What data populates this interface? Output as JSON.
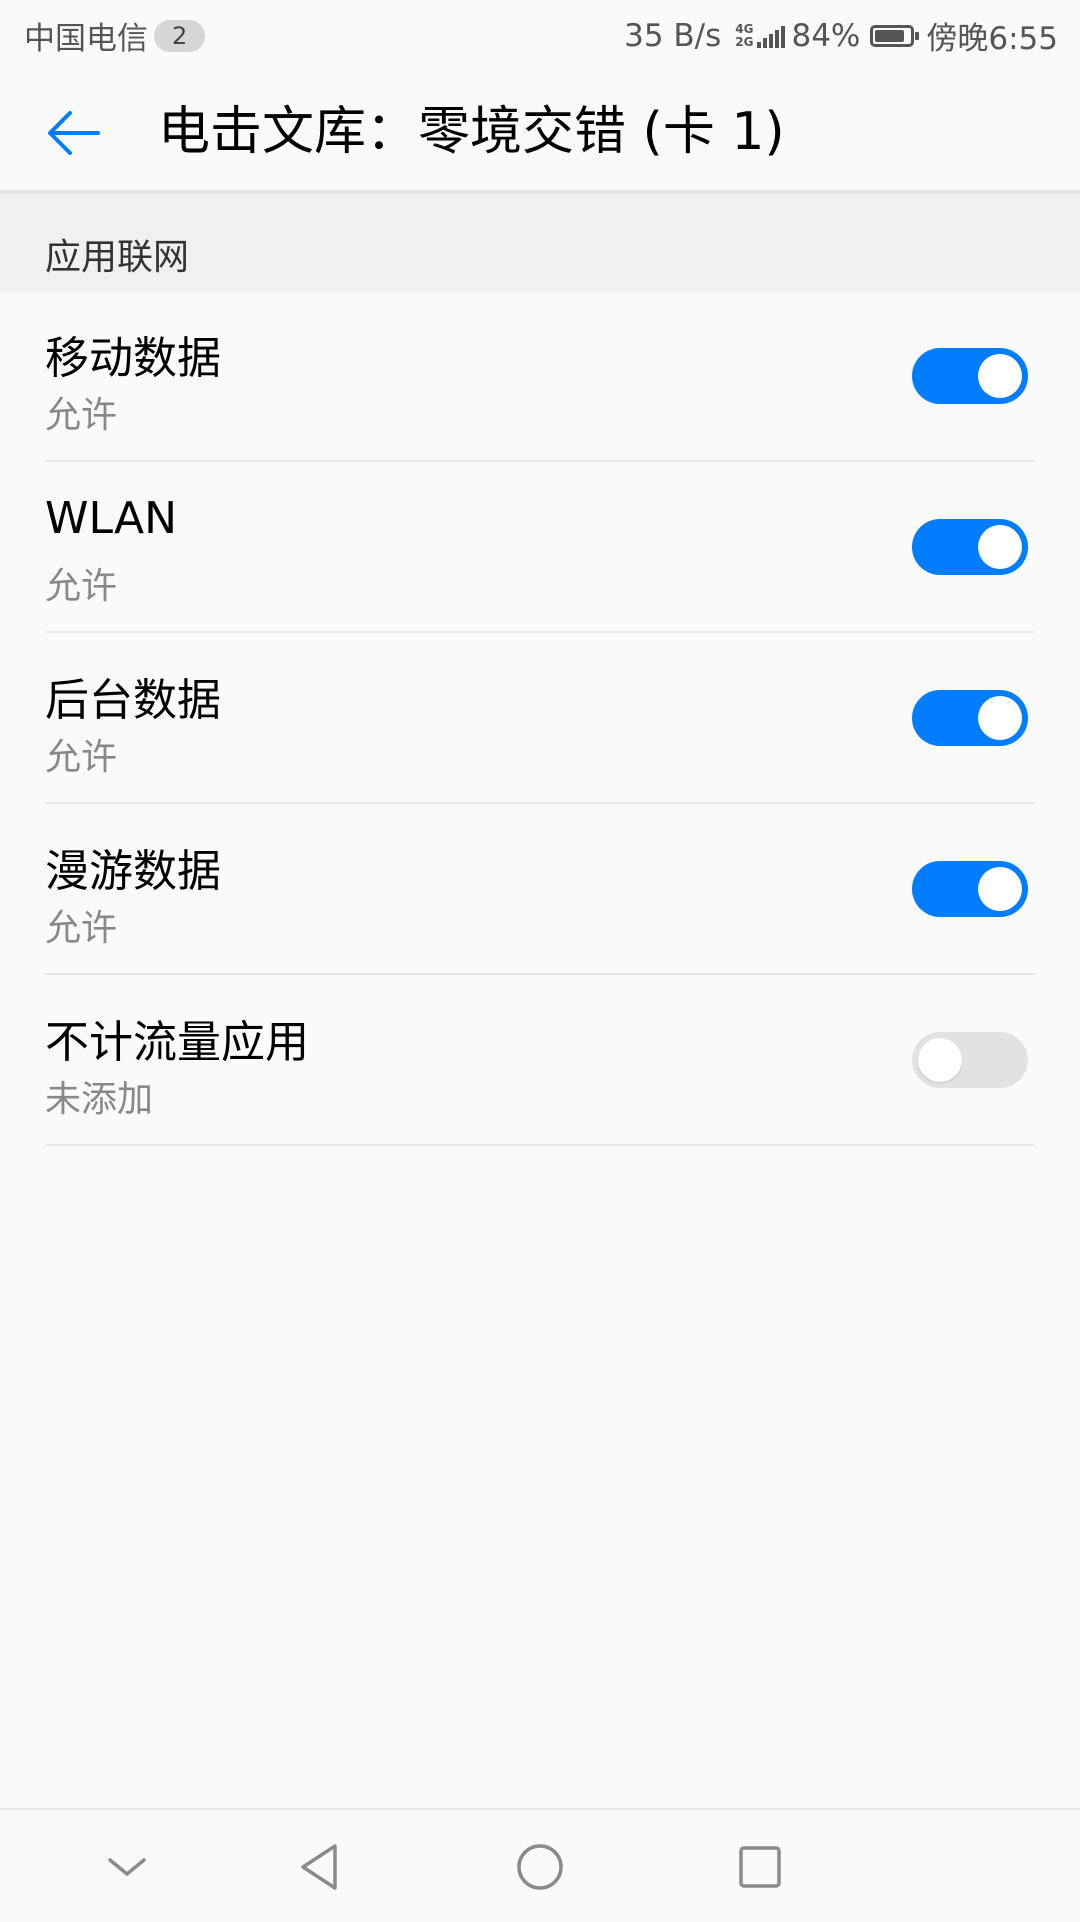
{
  "status_bar": {
    "carrier": "中国电信",
    "sim_badge": "2",
    "net_speed": "35 B/s",
    "network_top": "4G",
    "network_bottom": "2G",
    "battery_percent": "84%",
    "battery_level": 0.84,
    "time": "傍晚6:55"
  },
  "header": {
    "back_icon": "arrow-left-icon",
    "title": "电击文库：零境交错 (卡 1)",
    "accent_color": "#007dff"
  },
  "section": {
    "title": "应用联网"
  },
  "settings": [
    {
      "title": "移动数据",
      "subtitle": "允许",
      "enabled": true
    },
    {
      "title": "WLAN",
      "subtitle": "允许",
      "enabled": true
    },
    {
      "title": "后台数据",
      "subtitle": "允许",
      "enabled": true
    },
    {
      "title": "漫游数据",
      "subtitle": "允许",
      "enabled": true
    },
    {
      "title": "不计流量应用",
      "subtitle": "未添加",
      "enabled": false
    }
  ],
  "nav_bar": {
    "icons": [
      "chevron-down-icon",
      "back-triangle-icon",
      "home-circle-icon",
      "recents-square-icon"
    ]
  }
}
